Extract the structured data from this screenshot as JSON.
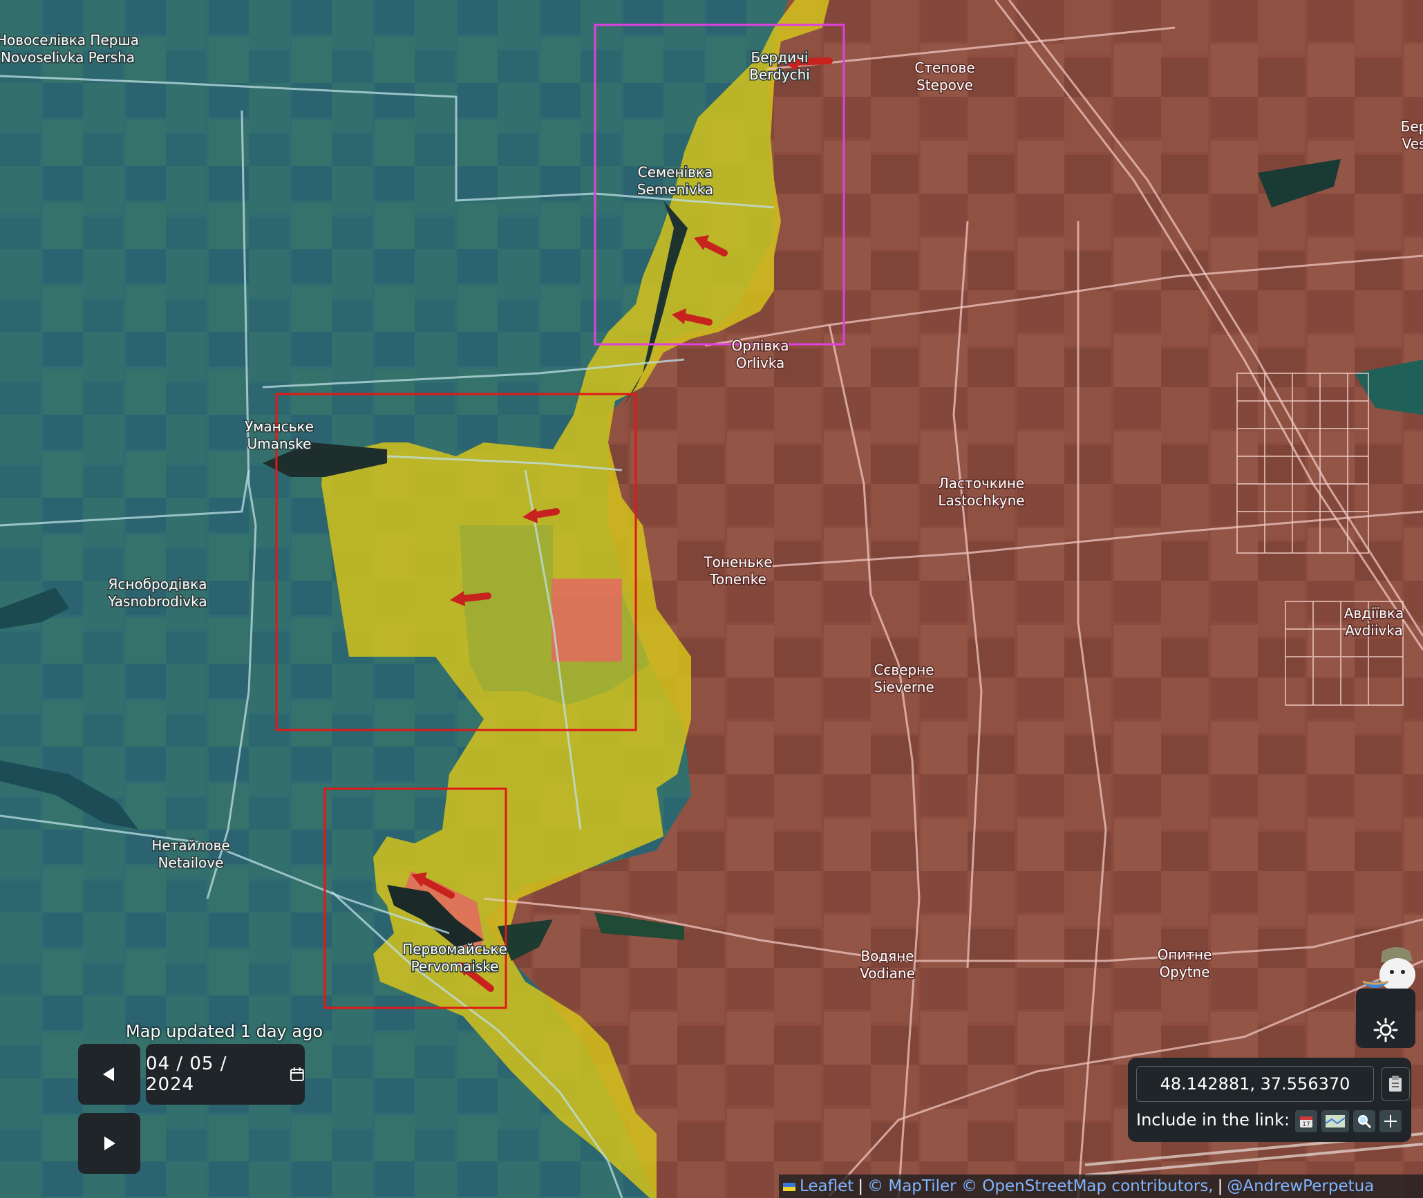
{
  "map": {
    "labels": [
      {
        "id": "novoselivka",
        "line1": "Новоселівка Перша",
        "line2": "Novoselivka Persha",
        "side": "ua"
      },
      {
        "id": "berdychi",
        "line1": "Бердичі",
        "line2": "Berdychi",
        "side": "ua"
      },
      {
        "id": "stepove",
        "line1": "Степове",
        "line2": "Stepove",
        "side": "ru"
      },
      {
        "id": "semenivka",
        "line1": "Семенівка",
        "line2": "Semenivka",
        "side": "ua"
      },
      {
        "id": "orlivka",
        "line1": "Орлівка",
        "line2": "Orlivka",
        "side": "ru"
      },
      {
        "id": "umanske",
        "line1": "Уманське",
        "line2": "Umanske",
        "side": "ua"
      },
      {
        "id": "lastochkyne",
        "line1": "Ласточкине",
        "line2": "Lastochkyne",
        "side": "ru"
      },
      {
        "id": "tonenke",
        "line1": "Тоненьке",
        "line2": "Tonenke",
        "side": "ru"
      },
      {
        "id": "yasnobrodivka",
        "line1": "Яснобродівка",
        "line2": "Yasnobrodivka",
        "side": "ua"
      },
      {
        "id": "avdiivka",
        "line1": "Авдіївка",
        "line2": "Avdiivka",
        "side": "ru"
      },
      {
        "id": "sieverne",
        "line1": "Сєверне",
        "line2": "Sieverne",
        "side": "ru"
      },
      {
        "id": "netailove",
        "line1": "Нетайлове",
        "line2": "Netailove",
        "side": "ua"
      },
      {
        "id": "pervomaiske",
        "line1": "Первомайське",
        "line2": "Pervomaiske",
        "side": "ua"
      },
      {
        "id": "vodiane",
        "line1": "Водяне",
        "line2": "Vodiane",
        "side": "ru"
      },
      {
        "id": "opytne",
        "line1": "Опитне",
        "line2": "Opytne",
        "side": "ru"
      },
      {
        "id": "bed_partial",
        "line1": "Бер",
        "line2": "Ves",
        "side": "ru"
      }
    ],
    "colors": {
      "ukraine_controlled": "#2e6e74",
      "russia_controlled": "#8a4a3c",
      "contested": "#d4c21c",
      "recent_advance": "#e46a60",
      "attack_arrow": "#c8221e",
      "highlight_magenta": "#e040e0",
      "highlight_red": "#e01818"
    }
  },
  "controls": {
    "updated_text": "Map updated 1 day ago",
    "date_month": "04",
    "date_day": "05",
    "date_year": "2024",
    "date_separator": "/",
    "prev_icon": "triangle-left",
    "next_icon": "triangle-right",
    "calendar_icon": "calendar"
  },
  "coords": {
    "value": "48.142881, 37.556370",
    "include_label": "Include in the link:",
    "include_icons": [
      "calendar-icon",
      "map-icon",
      "zoom-icon",
      "crosshair-icon"
    ]
  },
  "attribution": {
    "leaflet": "Leaflet",
    "maptiler": "© MapTiler",
    "osm": "© OpenStreetMap contributors,",
    "author": "@AndrewPerpetua",
    "sep": "|"
  }
}
